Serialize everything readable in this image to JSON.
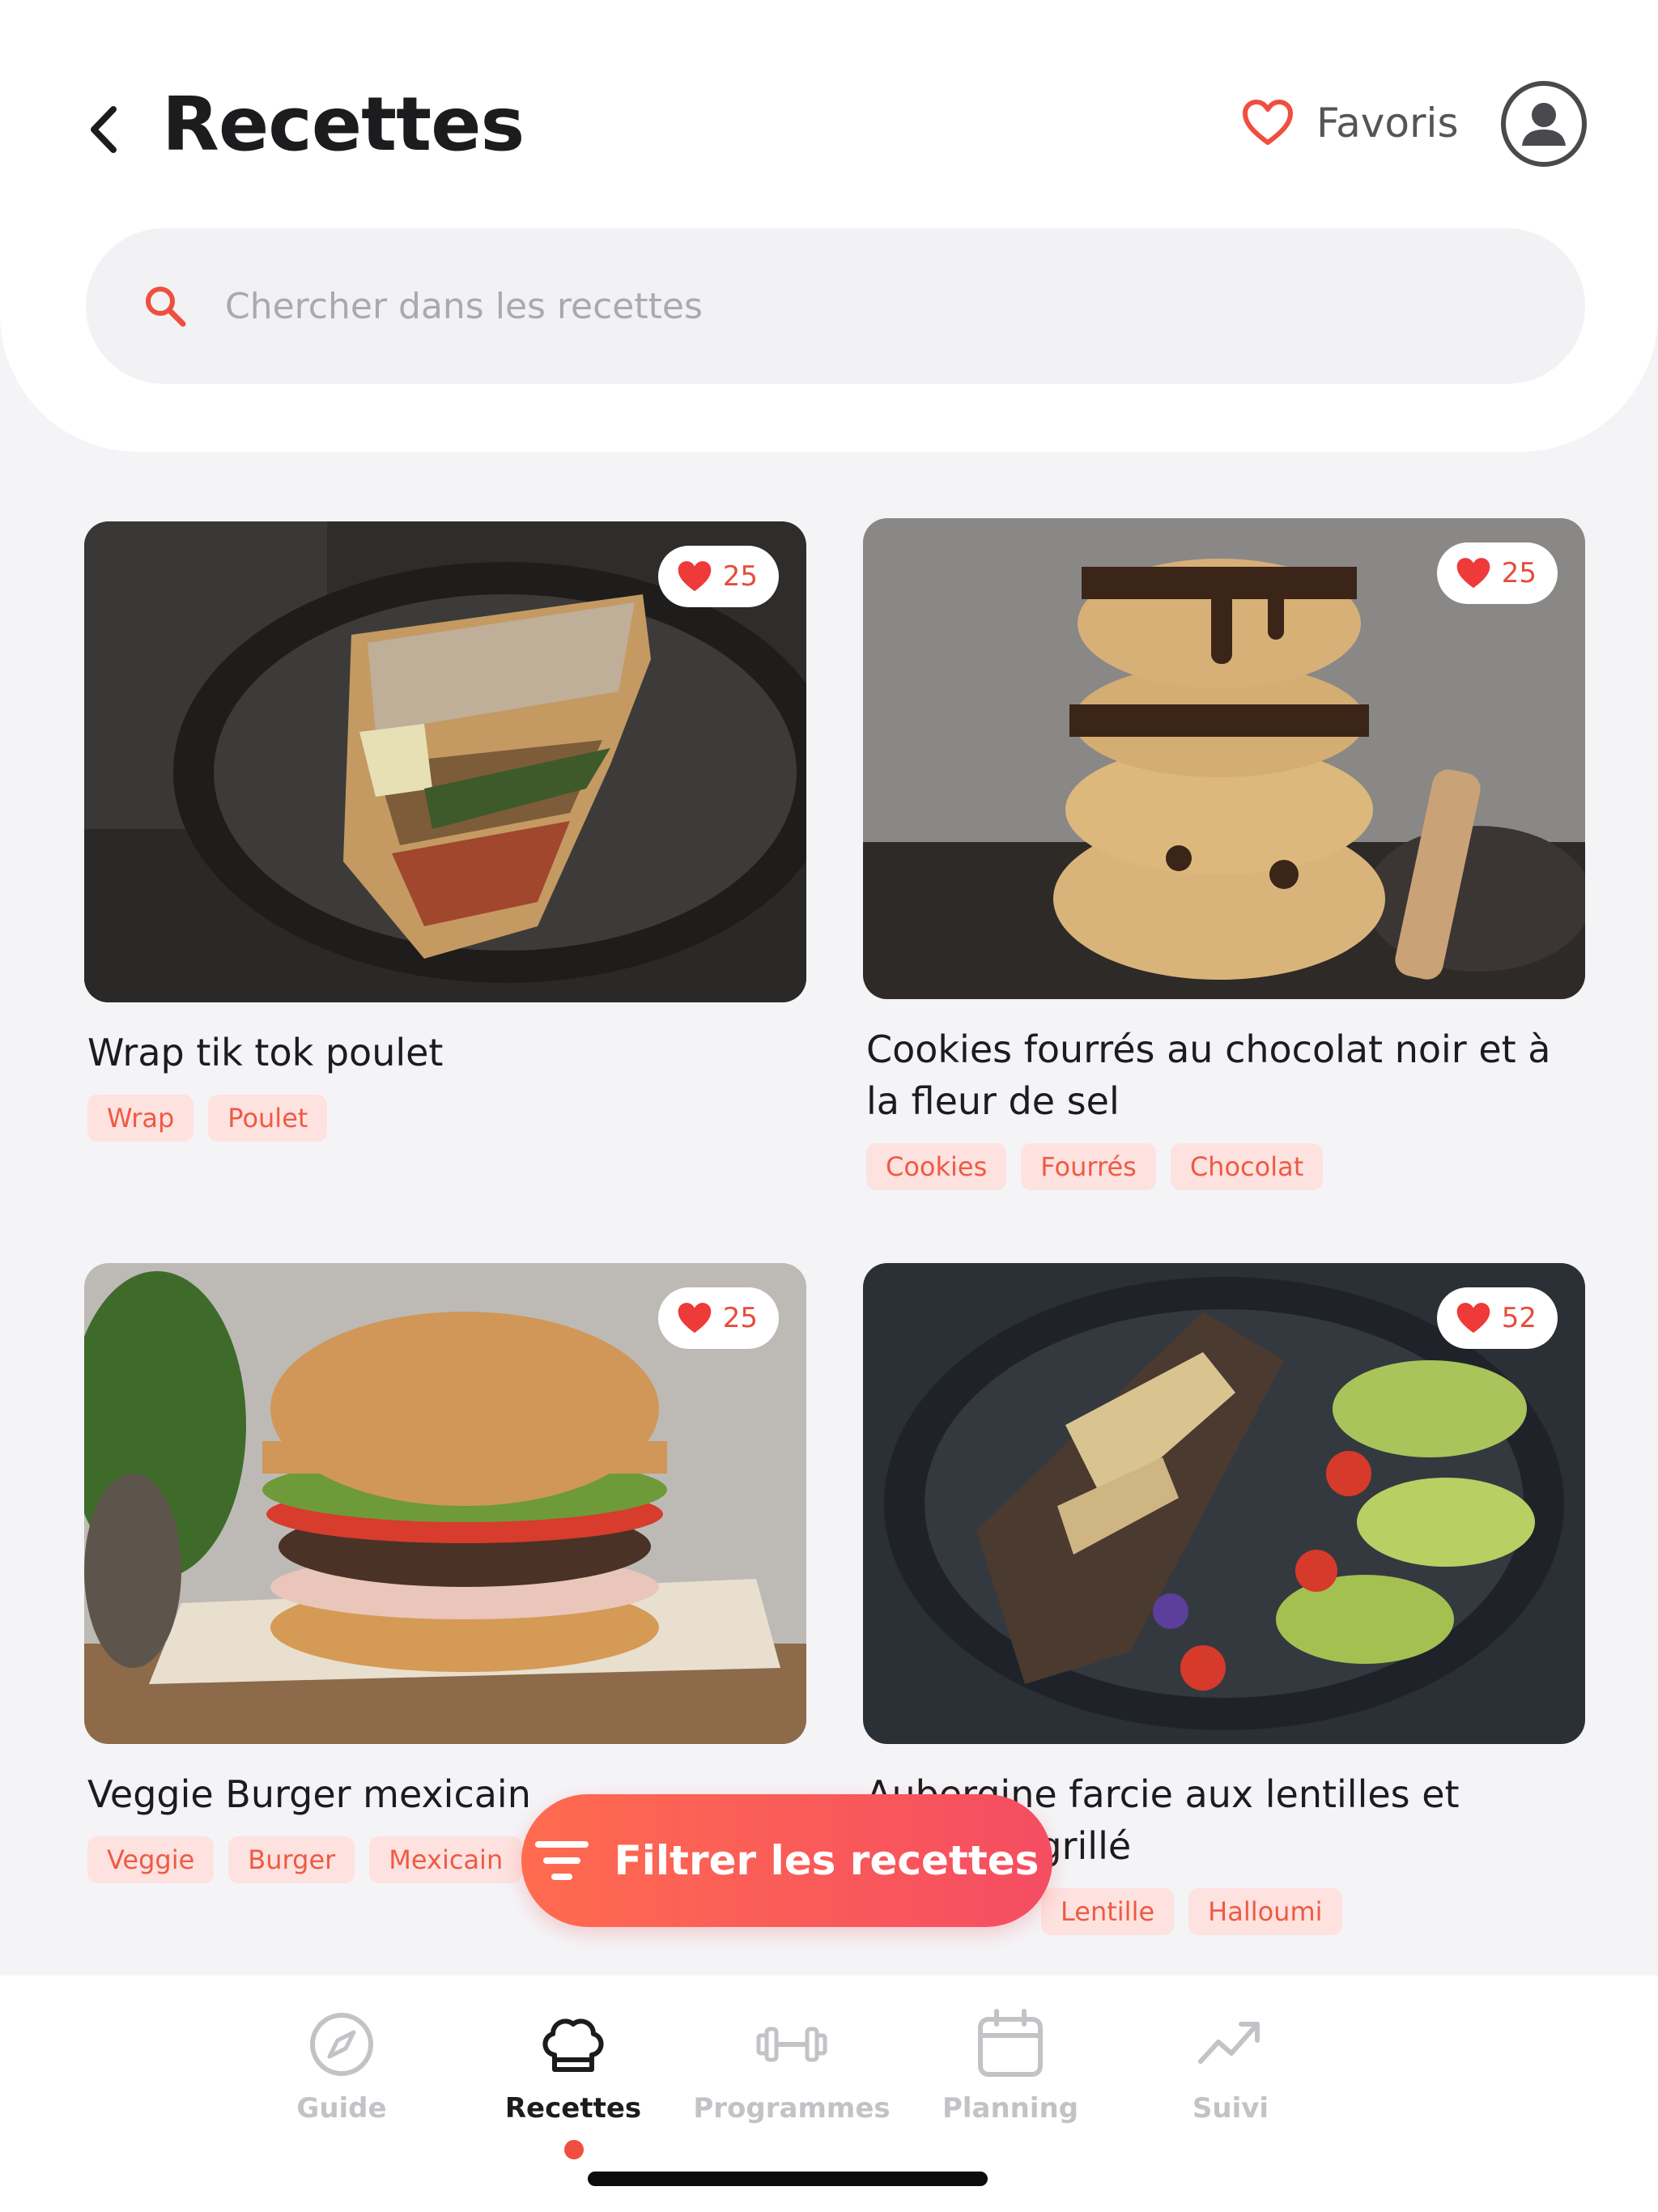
{
  "header": {
    "title": "Recettes",
    "favorites_label": "Favoris"
  },
  "search": {
    "placeholder": "Chercher dans les recettes"
  },
  "recipes": [
    {
      "title": "Wrap tik tok poulet",
      "likes": "25",
      "tags": [
        "Wrap",
        "Poulet"
      ]
    },
    {
      "title": "Cookies fourrés au chocolat noir et à la fleur de sel",
      "likes": "25",
      "tags": [
        "Cookies",
        "Fourrés",
        "Chocolat"
      ]
    },
    {
      "title": "Veggie Burger mexicain",
      "likes": "25",
      "tags": [
        "Veggie",
        "Burger",
        "Mexicain"
      ]
    },
    {
      "title": "Aubergine farcie aux lentilles et halloumi grillé",
      "likes": "52",
      "tags": [
        "Lentille",
        "Halloumi"
      ]
    }
  ],
  "filter_button": {
    "label": "Filtrer les recettes"
  },
  "tabbar": {
    "items": [
      {
        "label": "Guide",
        "icon": "compass-icon",
        "active": false
      },
      {
        "label": "Recettes",
        "icon": "chef-hat-icon",
        "active": true
      },
      {
        "label": "Programmes",
        "icon": "dumbbell-icon",
        "active": false
      },
      {
        "label": "Planning",
        "icon": "calendar-icon",
        "active": false
      },
      {
        "label": "Suivi",
        "icon": "trend-chart-icon",
        "active": false
      }
    ]
  },
  "colors": {
    "accent": "#f04e3e",
    "accent_gradient_end": "#f54d62",
    "tag_background": "#fde2df",
    "background": "#f4f4f7",
    "inactive": "#c3c3c7"
  }
}
